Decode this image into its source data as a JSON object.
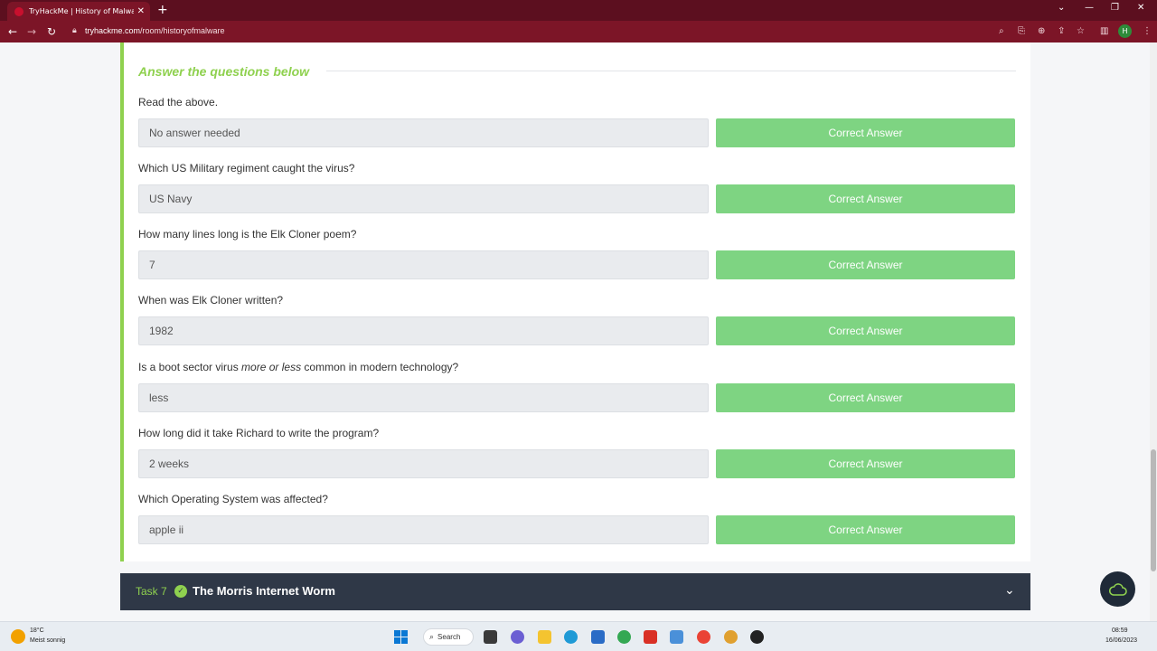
{
  "browser": {
    "tab_title": "TryHackMe | History of Malware",
    "url_host": "tryhackme.com",
    "url_path": "/room/historyofmalware",
    "profile_initial": "H"
  },
  "section": {
    "title": "Answer the questions below"
  },
  "questions": [
    {
      "label": "Read the above.",
      "answer": "No answer needed",
      "button": "Correct Answer"
    },
    {
      "label": "Which US Military regiment caught the virus?",
      "answer": "US Navy",
      "button": "Correct Answer"
    },
    {
      "label": "How many lines long is the Elk Cloner poem?",
      "answer": "7",
      "button": "Correct Answer"
    },
    {
      "label": "When was Elk Cloner written?",
      "answer": "1982",
      "button": "Correct Answer"
    },
    {
      "label_pre": "Is a boot sector virus ",
      "label_em": "more or less",
      "label_post": " common in modern technology?",
      "answer": "less",
      "button": "Correct Answer"
    },
    {
      "label": "How long did it take Richard to write the program?",
      "answer": "2 weeks",
      "button": "Correct Answer"
    },
    {
      "label": "Which Operating System was affected?",
      "answer": "apple ii",
      "button": "Correct Answer"
    }
  ],
  "next_task": {
    "number": "Task 7",
    "title": "The Morris Internet Worm"
  },
  "taskbar": {
    "weather_temp": "18°C",
    "weather_desc": "Meist sonnig",
    "search_label": "Search",
    "time": "08:59",
    "date": "16/06/2023"
  },
  "colors": {
    "accent_green": "#8fd14f",
    "button_green": "#7ed482",
    "browser_red": "#7c1527",
    "task_bar_bg": "#2f3847"
  }
}
